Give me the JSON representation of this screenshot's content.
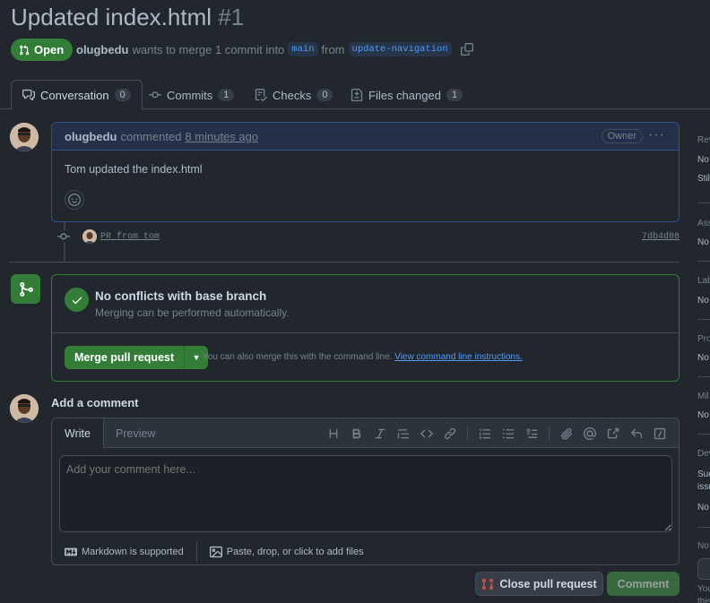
{
  "pr": {
    "title": "Updated index.html",
    "number": "#1",
    "state": "Open",
    "author": "olugbedu",
    "merge_text": "wants to merge 1 commit into",
    "base_branch": "main",
    "from_text": "from",
    "head_branch": "update-navigation"
  },
  "tabs": [
    {
      "label": "Conversation",
      "count": "0"
    },
    {
      "label": "Commits",
      "count": "1"
    },
    {
      "label": "Checks",
      "count": "0"
    },
    {
      "label": "Files changed",
      "count": "1"
    }
  ],
  "comment": {
    "author": "olugbedu",
    "action": "commented",
    "time": "8 minutes ago",
    "badge": "Owner",
    "menu": "···",
    "body": "Tom updated the index.html"
  },
  "commit": {
    "message": "PR from tom",
    "sha": "7db4d08"
  },
  "merge": {
    "title": "No conflicts with base branch",
    "subtitle": "Merging can be performed automatically.",
    "button": "Merge pull request",
    "hint": "You can also merge this with the command line.",
    "hint_link": "View command line instructions."
  },
  "add_comment": {
    "title": "Add a comment",
    "tab_write": "Write",
    "tab_preview": "Preview",
    "placeholder": "Add your comment here...",
    "markdown_note": "Markdown is supported",
    "attach_note": "Paste, drop, or click to add files"
  },
  "buttons": {
    "close": "Close pull request",
    "comment": "Comment"
  },
  "sidebar": {
    "items": [
      {
        "label": "Rev",
        "values": [
          "No",
          "Stil"
        ]
      },
      {
        "label": "Ass",
        "values": [
          "No"
        ]
      },
      {
        "label": "Lab",
        "values": [
          "No"
        ]
      },
      {
        "label": "Pro",
        "values": [
          "No"
        ]
      },
      {
        "label": "Mil",
        "values": [
          "No"
        ]
      },
      {
        "label": "Dev",
        "values": [
          "Suc",
          "issu",
          "No"
        ]
      },
      {
        "label": "No",
        "values": [
          "",
          "You",
          "this"
        ]
      }
    ]
  },
  "colors": {
    "bg": "#22272e",
    "accent_green": "#347d39",
    "link": "#539bf5",
    "border": "#444c56"
  }
}
